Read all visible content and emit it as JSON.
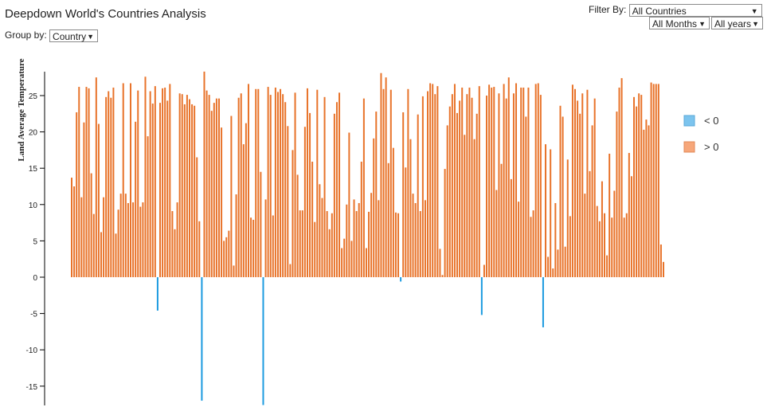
{
  "title": "Deepdown World's Countries Analysis",
  "group_by": {
    "label": "Group by:",
    "value": "Country"
  },
  "filter": {
    "label": "Filter By:",
    "country": "All Countries",
    "month": "All Months",
    "year": "All years"
  },
  "colors": {
    "positive": "#e8732a",
    "negative": "#1c9be0",
    "legend_positive": "#f7a77a",
    "legend_negative": "#7cc4ee"
  },
  "chart_data": {
    "type": "bar",
    "ylabel": "Land Average Temperature",
    "ylim": [
      -17.8,
      28.5
    ],
    "y_ticks": [
      "25",
      "20",
      "15",
      "10",
      "5",
      "0",
      "-5",
      "-10",
      "-15"
    ],
    "grid": false,
    "legend": {
      "placement": "right",
      "entries": [
        "< 0",
        "> 0"
      ]
    },
    "values": [
      13.7,
      12.5,
      22.7,
      26.2,
      11.0,
      21.3,
      26.2,
      26.0,
      14.3,
      8.7,
      27.5,
      21.1,
      6.2,
      11.0,
      24.8,
      25.6,
      24.7,
      26.1,
      6.0,
      9.3,
      11.5,
      26.7,
      11.5,
      10.2,
      26.7,
      10.3,
      21.4,
      25.7,
      9.7,
      10.3,
      27.6,
      19.4,
      25.6,
      23.9,
      26.3,
      -4.6,
      24.0,
      26.0,
      26.1,
      24.3,
      26.6,
      9.1,
      6.6,
      10.3,
      25.3,
      25.2,
      23.8,
      25.1,
      24.5,
      23.8,
      23.6,
      16.5,
      7.7,
      -17.0,
      28.3,
      25.7,
      25.1,
      22.9,
      24.0,
      24.6,
      24.6,
      20.6,
      5.0,
      5.5,
      6.4,
      22.2,
      1.6,
      11.4,
      24.7,
      25.3,
      18.3,
      21.2,
      26.6,
      8.2,
      7.9,
      25.9,
      25.9,
      14.5,
      -17.6,
      10.7,
      26.2,
      25.1,
      8.5,
      26.1,
      25.5,
      25.9,
      25.2,
      24.1,
      20.8,
      1.8,
      17.5,
      25.4,
      14.1,
      9.2,
      9.2,
      20.7,
      26.0,
      22.6,
      15.9,
      7.6,
      25.8,
      12.8,
      10.9,
      24.8,
      9.1,
      6.6,
      8.8,
      22.5,
      24.1,
      25.4,
      4.0,
      5.3,
      10.0,
      19.9,
      5.0,
      10.7,
      9.1,
      10.2,
      15.9,
      24.6,
      4.0,
      9.0,
      11.6,
      19.1,
      22.8,
      10.6,
      28.1,
      25.9,
      27.5,
      15.7,
      25.8,
      17.8,
      8.9,
      8.8,
      -0.6,
      22.7,
      15.1,
      25.9,
      19.0,
      11.5,
      10.2,
      22.4,
      9.1,
      24.9,
      10.6,
      25.6,
      26.7,
      26.6,
      25.2,
      26.3,
      3.9,
      0.3,
      14.9,
      20.9,
      23.5,
      25.2,
      26.6,
      22.6,
      24.3,
      26.1,
      19.6,
      25.2,
      26.1,
      24.7,
      19.0,
      22.5,
      26.3,
      -5.2,
      1.7,
      25.0,
      26.5,
      26.1,
      26.2,
      12.0,
      25.3,
      15.6,
      26.6,
      24.6,
      27.5,
      13.5,
      25.3,
      26.7,
      10.4,
      26.1,
      26.1,
      22.1,
      26.1,
      8.3,
      9.2,
      26.6,
      26.7,
      25.1,
      -6.9,
      18.3,
      2.8,
      17.6,
      1.2,
      10.2,
      3.8,
      23.6,
      22.1,
      4.2,
      16.2,
      8.4,
      26.5,
      25.9,
      24.3,
      22.5,
      25.3,
      11.5,
      25.8,
      14.6,
      20.9,
      24.6,
      9.8,
      7.7,
      13.2,
      8.8,
      3.0,
      17.0,
      8.2,
      11.9,
      22.8,
      26.1,
      27.4,
      8.2,
      8.8,
      17.1,
      13.9,
      24.8,
      23.5,
      25.3,
      25.1,
      20.3,
      21.7,
      20.9,
      26.8,
      26.6,
      26.6,
      26.6,
      4.5,
      2.1
    ],
    "legend_swatch_values": []
  }
}
